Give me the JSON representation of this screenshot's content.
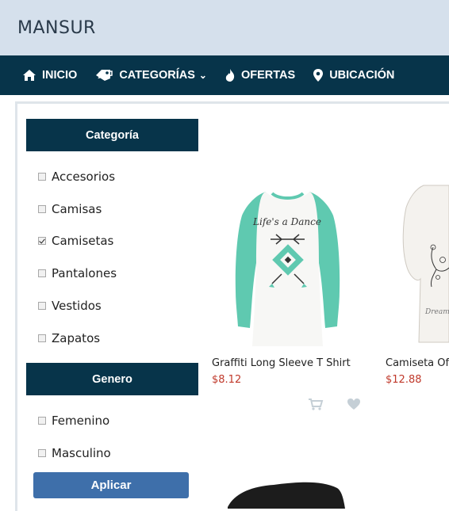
{
  "brand": {
    "logo": "MANSUR"
  },
  "nav": {
    "items": [
      {
        "label": "INICIO",
        "icon": "home-icon"
      },
      {
        "label": "CATEGORÍAS",
        "icon": "tag-icon",
        "chevron": "⌄"
      },
      {
        "label": "OFERTAS",
        "icon": "fire-icon"
      },
      {
        "label": "UBICACIÓN",
        "icon": "map-pin-icon"
      }
    ]
  },
  "sidebar": {
    "category_title": "Categoría",
    "categories": [
      {
        "label": "Accesorios",
        "checked": false
      },
      {
        "label": "Camisas",
        "checked": false
      },
      {
        "label": "Camisetas",
        "checked": true
      },
      {
        "label": "Pantalones",
        "checked": false
      },
      {
        "label": "Vestidos",
        "checked": false
      },
      {
        "label": "Zapatos",
        "checked": false
      }
    ],
    "gender_title": "Genero",
    "genders": [
      {
        "label": "Femenino",
        "checked": false
      },
      {
        "label": "Masculino",
        "checked": false
      }
    ],
    "apply_label": "Aplicar"
  },
  "products": [
    {
      "name": "Graffiti Long Sleeve T Shirt",
      "price": "$8.12",
      "shirt_text": "Life's a Dance"
    },
    {
      "name": "Camiseta Of",
      "price": "$12.88"
    }
  ],
  "colors": {
    "nav_bg": "#07344a",
    "topbar_bg": "#d5e0ec",
    "price": "#c0392b",
    "apply_bg": "#3e6faa",
    "shirt_sleeve": "#5fc9b0"
  }
}
